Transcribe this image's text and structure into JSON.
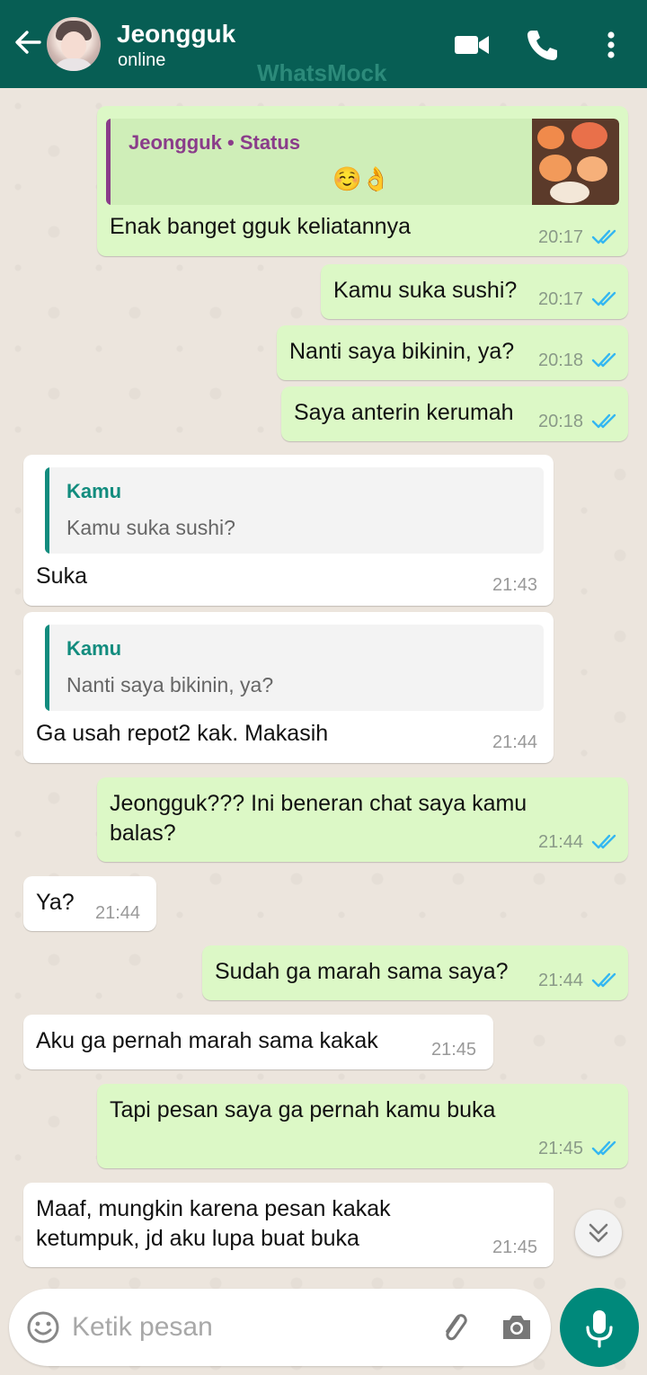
{
  "header": {
    "contact_name": "Jeongguk",
    "contact_status": "online",
    "watermark": "WhatsMock",
    "back_icon": "arrow-left-icon",
    "video_icon": "video-camera-icon",
    "call_icon": "phone-icon",
    "menu_icon": "more-vertical-icon"
  },
  "colors": {
    "header": "#075e54",
    "outgoing_bubble": "#dcf8c6",
    "incoming_bubble": "#ffffff",
    "read_ticks": "#34b7f1",
    "status_quote_accent": "#8a3c8a",
    "reply_quote_accent": "#128c7e",
    "mic_button": "#00897b"
  },
  "messages": [
    {
      "dir": "out",
      "quote_title": "Jeongguk • Status",
      "quote_emoji": "☺️👌",
      "text": "Enak banget gguk keliatannya",
      "time": "20:17"
    },
    {
      "dir": "out",
      "text": "Kamu suka sushi?",
      "time": "20:17"
    },
    {
      "dir": "out",
      "text": "Nanti saya bikinin, ya?",
      "time": "20:18"
    },
    {
      "dir": "out",
      "text": "Saya anterin kerumah",
      "time": "20:18"
    },
    {
      "dir": "in",
      "quote_title": "Kamu",
      "quote_text": "Kamu suka sushi?",
      "text": "Suka",
      "time": "21:43"
    },
    {
      "dir": "in",
      "quote_title": "Kamu",
      "quote_text": "Nanti saya bikinin, ya?",
      "text": "Ga usah repot2 kak. Makasih",
      "time": "21:44"
    },
    {
      "dir": "out",
      "text_line1": "Jeongguk??? Ini beneran chat saya kamu",
      "text_line2": "balas?",
      "time": "21:44"
    },
    {
      "dir": "in",
      "text": "Ya?",
      "time": "21:44"
    },
    {
      "dir": "out",
      "text": "Sudah ga marah sama saya?",
      "time": "21:44"
    },
    {
      "dir": "in",
      "text": "Aku ga pernah marah sama kakak",
      "time": "21:45"
    },
    {
      "dir": "out",
      "text": "Tapi pesan saya ga pernah kamu buka",
      "time": "21:45"
    },
    {
      "dir": "in",
      "text_line1": "Maaf, mungkin karena pesan kakak",
      "text_line2": "ketumpuk, jd aku lupa buat buka",
      "time": "21:45"
    }
  ],
  "composer": {
    "placeholder": "Ketik pesan",
    "emoji_icon": "emoji-icon",
    "attach_icon": "paperclip-icon",
    "camera_icon": "camera-icon",
    "mic_icon": "microphone-icon",
    "scroll_icon": "double-chevron-down-icon"
  }
}
